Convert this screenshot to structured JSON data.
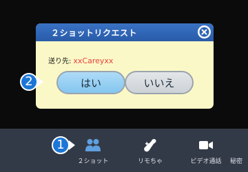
{
  "dialog": {
    "title": "２ショットリクエスト",
    "recipient_label": "送り先:",
    "recipient_name": "xxCareyxx",
    "yes_label": "はい",
    "no_label": "いいえ",
    "close_icon": "close-icon"
  },
  "markers": {
    "step1": "1",
    "step2": "2"
  },
  "toolbar": {
    "items": [
      {
        "label": "２ショット",
        "icon": "two-person-icon"
      },
      {
        "label": "リモちゃ",
        "icon": "remote-toy-icon"
      },
      {
        "label": "ビデオ通話",
        "icon": "video-camera-icon"
      },
      {
        "label": "秘密"
      }
    ]
  },
  "colors": {
    "dialog_header": "#2f64b5",
    "dialog_body": "#fbf8c7",
    "recipient_name": "#e8423f",
    "yes_button": "#9fd3f4",
    "no_button": "#d6dade",
    "toolbar": "#333a47",
    "marker": "#1c76d6"
  }
}
